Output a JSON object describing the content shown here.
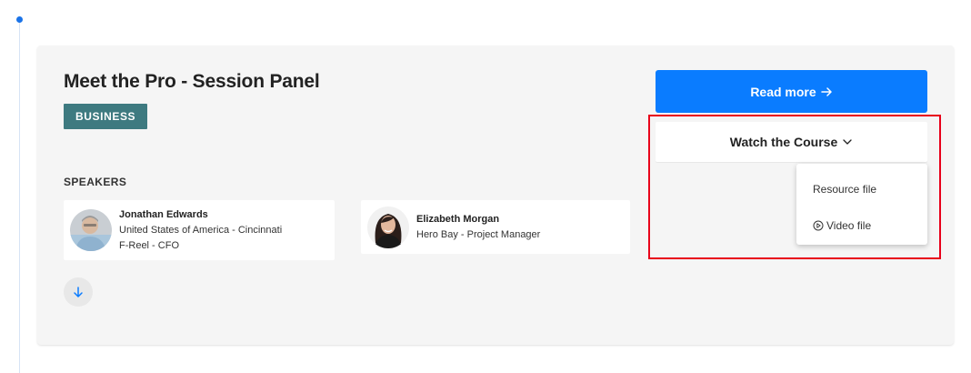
{
  "session": {
    "title": "Meet the Pro - Session Panel",
    "category": "BUSINESS"
  },
  "speakers": {
    "heading": "SPEAKERS",
    "items": [
      {
        "name": "Jonathan Edwards",
        "location": "United States of America - Cincinnati",
        "role": "F-Reel - CFO"
      },
      {
        "name": "Elizabeth Morgan",
        "role": "Hero Bay - Project Manager"
      }
    ]
  },
  "actions": {
    "read_more_label": "Read more",
    "read_more_icon": "arrow-right-icon",
    "watch_course_label": "Watch the Course",
    "watch_course_icon": "chevron-down-icon",
    "scroll_icon": "arrow-down-icon"
  },
  "dropdown": {
    "items": [
      {
        "label": "Resource file"
      },
      {
        "label": "Video file",
        "icon": "play-circle-icon"
      }
    ]
  },
  "colors": {
    "accent": "#0a7cff",
    "badge": "#3e7a80",
    "highlight": "#e8001a",
    "card_background": "#f5f5f5"
  }
}
